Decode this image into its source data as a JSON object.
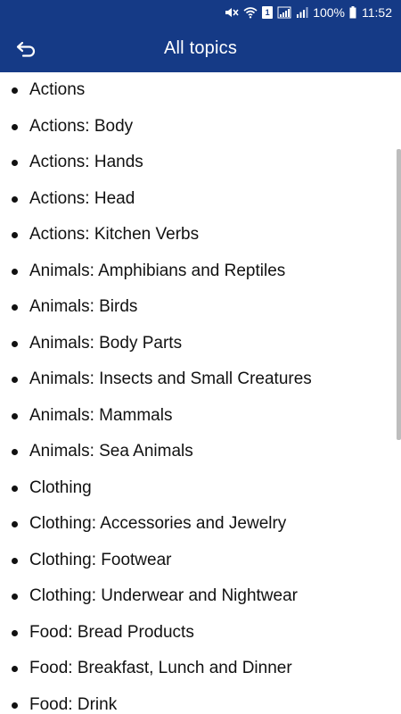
{
  "status_bar": {
    "notification_badge": "1",
    "battery_text": "100%",
    "time": "11:52",
    "icons": [
      "mute-icon",
      "wifi-icon",
      "sim-icon",
      "signal-icon",
      "battery-icon"
    ]
  },
  "app_bar": {
    "title": "All topics",
    "back_icon": "back-arrow-icon"
  },
  "topics": [
    "Actions",
    "Actions: Body",
    "Actions: Hands",
    "Actions: Head",
    "Actions: Kitchen Verbs",
    "Animals: Amphibians and Reptiles",
    "Animals: Birds",
    "Animals: Body Parts",
    "Animals: Insects and Small Creatures",
    "Animals: Mammals",
    "Animals: Sea Animals",
    "Clothing",
    "Clothing: Accessories and Jewelry",
    "Clothing: Footwear",
    "Clothing: Underwear and Nightwear",
    "Food: Bread Products",
    "Food: Breakfast, Lunch and Dinner",
    "Food: Drink"
  ],
  "colors": {
    "app_bar": "#153a86",
    "text": "#111111",
    "scrollbar": "#bdbdbd"
  }
}
